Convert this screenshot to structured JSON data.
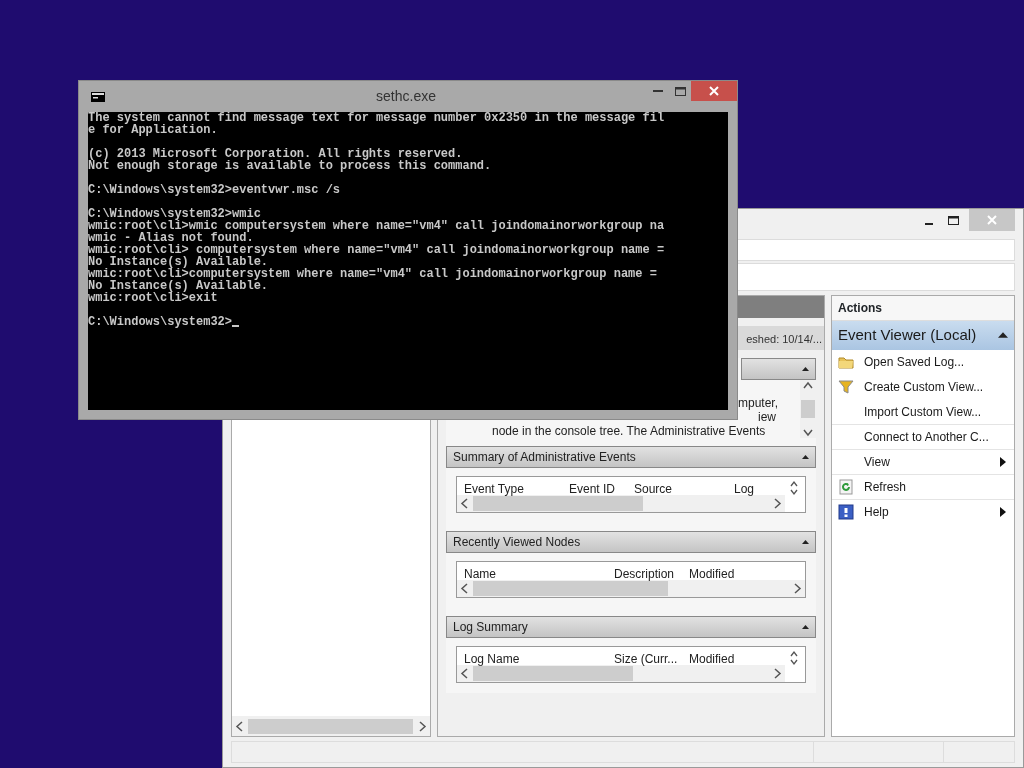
{
  "console": {
    "title": "sethc.exe",
    "blocks": [
      [
        "The system cannot find message text for message number 0x2350 in the message fil",
        "e for Application."
      ],
      [
        "(c) 2013 Microsoft Corporation. All rights reserved.",
        "Not enough storage is available to process this command."
      ],
      [
        "C:\\Windows\\system32>eventvwr.msc /s"
      ],
      [
        "C:\\Windows\\system32>wmic",
        "wmic:root\\cli>wmic computersystem where name=\"vm4\" call joindomainorworkgroup na",
        "wmic - Alias not found.",
        "wmic:root\\cli> computersystem where name=\"vm4\" call joindomainorworkgroup name =",
        "No Instance(s) Available.",
        "wmic:root\\cli>computersystem where name=\"vm4\" call joindomainorworkgroup name =",
        "No Instance(s) Available.",
        "wmic:root\\cli>exit"
      ],
      [
        "C:\\Windows\\system32>"
      ]
    ]
  },
  "event_viewer": {
    "center": {
      "refresh_text": "eshed: 10/14/...",
      "overview_lines": [
        "mputer,",
        "iew",
        "node in the console tree. The Administrative Events"
      ],
      "sections": [
        {
          "title": "Summary of Administrative Events",
          "expanded": true,
          "columns": [
            "Event Type",
            "Event ID",
            "Source",
            "Log"
          ]
        },
        {
          "title": "Recently Viewed Nodes",
          "expanded": true,
          "columns": [
            "Name",
            "Description",
            "Modified"
          ]
        },
        {
          "title": "Log Summary",
          "expanded": true,
          "columns": [
            "Log Name",
            "Size (Curr...",
            "Modified"
          ]
        }
      ]
    },
    "actions": {
      "title": "Actions",
      "group": "Event Viewer (Local)",
      "expanded": true,
      "items": [
        {
          "label": "Open Saved Log...",
          "submenu": false
        },
        {
          "label": "Create Custom View...",
          "submenu": false
        },
        {
          "label": "Import Custom View...",
          "submenu": false
        },
        {
          "label": "Connect to Another C...",
          "submenu": false
        },
        {
          "label": "View",
          "submenu": true
        },
        {
          "label": "Refresh",
          "submenu": false
        },
        {
          "label": "Help",
          "submenu": true
        }
      ]
    }
  }
}
